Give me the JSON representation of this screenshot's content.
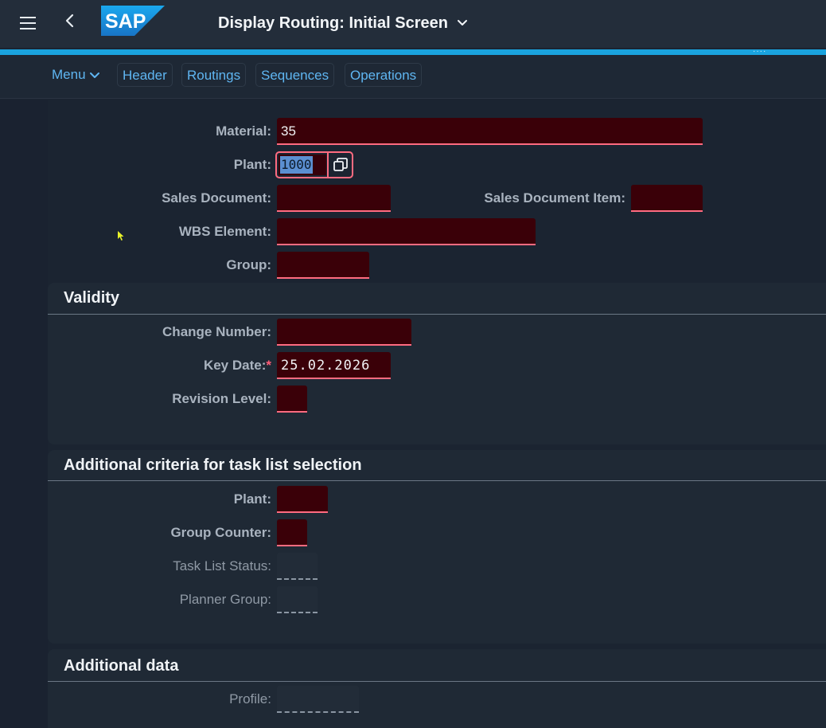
{
  "shell": {
    "title": "Display Routing: Initial Screen",
    "logo_text": "SAP",
    "menu_icon": "hamburger-icon",
    "back_icon": "chevron-left-icon"
  },
  "toolbar": {
    "menu_label": "Menu",
    "header_label": "Header",
    "routings_label": "Routings",
    "sequences_label": "Sequences",
    "operations_label": "Operations"
  },
  "form": {
    "material_label": "Material:",
    "material_value": "35",
    "plant_label": "Plant:",
    "plant_value": "1000",
    "sales_document_label": "Sales Document:",
    "sales_document_value": "",
    "sales_document_item_label": "Sales Document Item:",
    "sales_document_item_value": "",
    "wbs_element_label": "WBS Element:",
    "wbs_element_value": "",
    "group_label": "Group:",
    "group_value": ""
  },
  "validity": {
    "title": "Validity",
    "change_number_label": "Change Number:",
    "change_number_value": "",
    "key_date_label": "Key Date:",
    "key_date_required": "*",
    "key_date_value": "25.02.2026",
    "revision_level_label": "Revision Level:",
    "revision_level_value": ""
  },
  "additional_criteria": {
    "title": "Additional criteria for task list selection",
    "plant_label": "Plant:",
    "plant_value": "",
    "group_counter_label": "Group Counter:",
    "group_counter_value": "",
    "task_list_status_label": "Task List Status:",
    "task_list_status_value": "",
    "planner_group_label": "Planner Group:",
    "planner_group_value": ""
  },
  "additional_data": {
    "title": "Additional data",
    "profile_label": "Profile:",
    "profile_value": ""
  },
  "colors": {
    "accent": "#1aa3de",
    "link": "#5fb6f2",
    "field_bg": "#3a0008",
    "field_border": "#ff6b80"
  }
}
